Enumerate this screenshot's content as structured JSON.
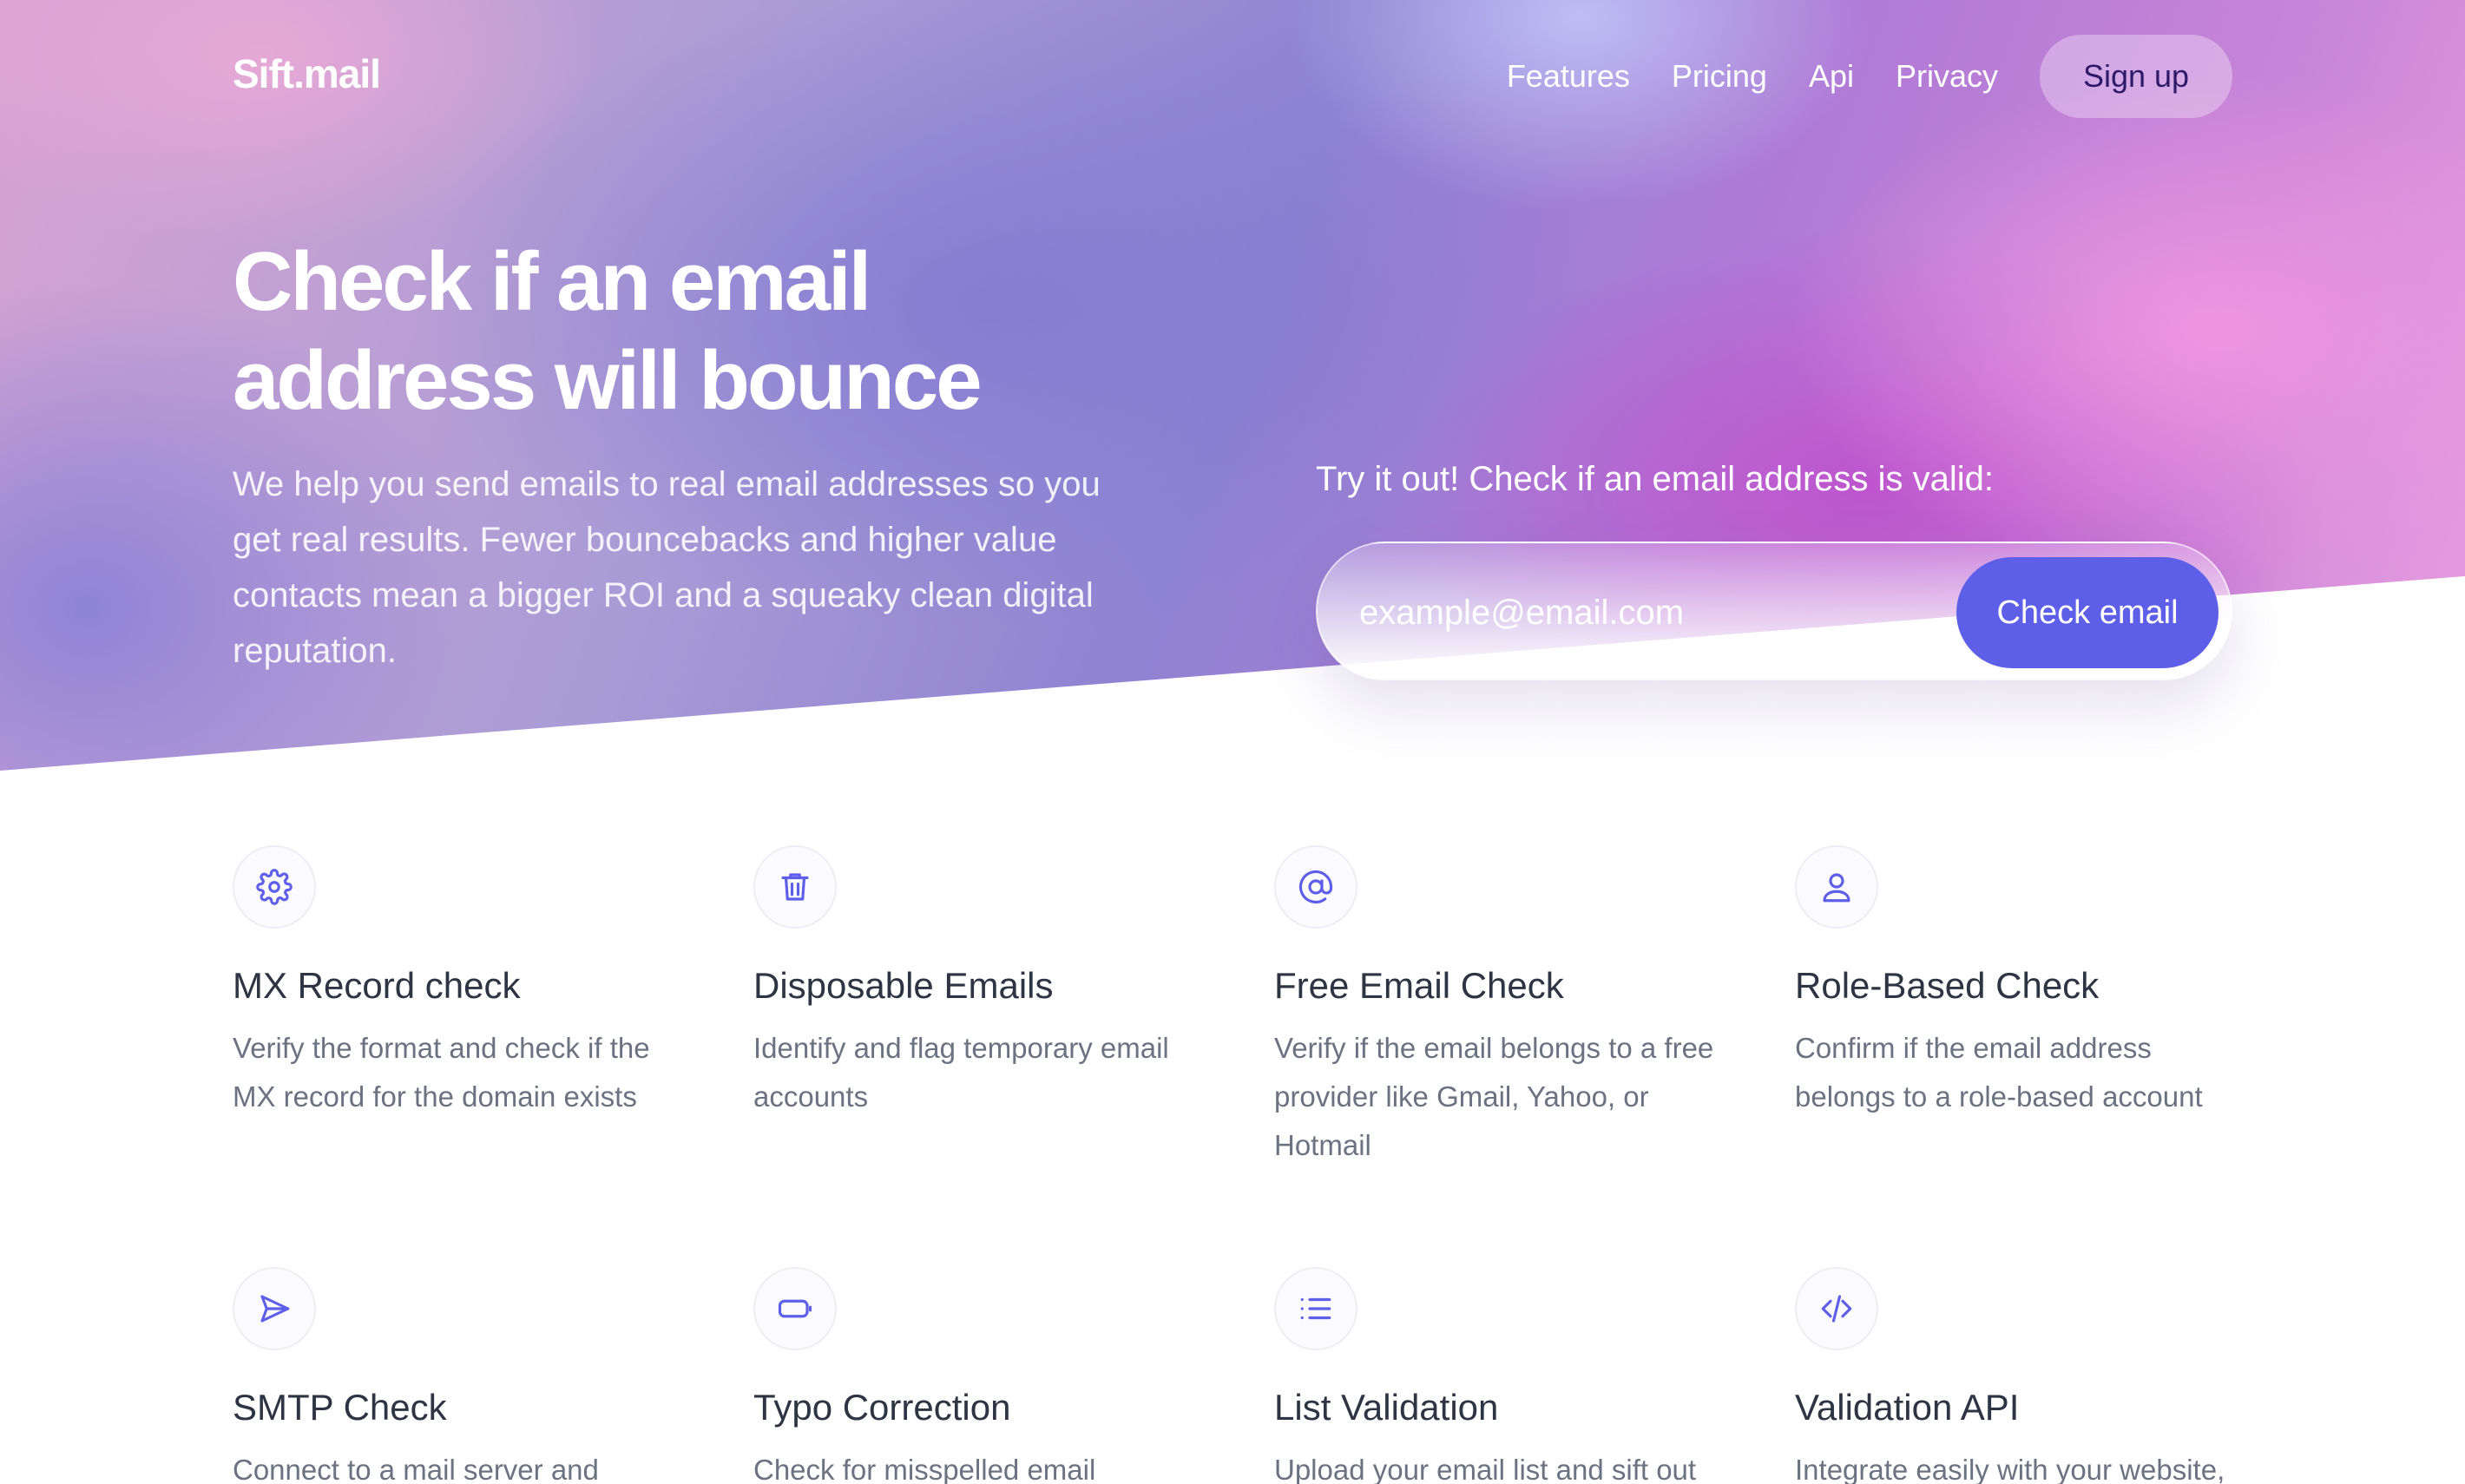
{
  "brand": {
    "name": "Sift.mail",
    "accent": "#5e5fe8"
  },
  "nav": {
    "links": [
      "Features",
      "Pricing",
      "Api",
      "Privacy"
    ],
    "signup_label": "Sign up"
  },
  "hero": {
    "title": "Check if an email address will bounce",
    "description": "We help you send emails to real email addresses so you get real results. Fewer bouncebacks and higher value contacts mean a bigger ROI and a squeaky clean digital reputation.",
    "try_label": "Try it out! Check if an email address is valid:",
    "email_placeholder": "example@email.com",
    "check_button_label": "Check email"
  },
  "features": [
    {
      "icon": "gear-icon",
      "title": "MX Record check",
      "description": "Verify the format and check if the MX record for the domain exists"
    },
    {
      "icon": "trash-icon",
      "title": "Disposable Emails",
      "description": "Identify and flag temporary email accounts"
    },
    {
      "icon": "at-sign-icon",
      "title": "Free Email Check",
      "description": "Verify if the email belongs to a free provider like Gmail, Yahoo, or Hotmail"
    },
    {
      "icon": "user-icon",
      "title": "Role-Based Check",
      "description": "Confirm if the email address belongs to a role-based account"
    },
    {
      "icon": "send-icon",
      "title": "SMTP Check",
      "description": "Connect to a mail server and"
    },
    {
      "icon": "battery-icon",
      "title": "Typo Correction",
      "description": "Check for misspelled email"
    },
    {
      "icon": "list-icon",
      "title": "List Validation",
      "description": "Upload your email list and sift out"
    },
    {
      "icon": "code-icon",
      "title": "Validation API",
      "description": "Integrate easily with your website,"
    }
  ]
}
